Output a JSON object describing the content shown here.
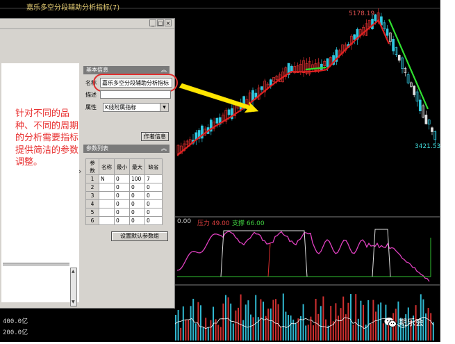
{
  "chart": {
    "title": "嘉乐多空分段辅助分析指标(7)",
    "price_high": "5178.19",
    "price_low": "3421.53",
    "indicator_prefix": "0.00",
    "indicator_pressure": "压力 49.00",
    "indicator_support": "支撑 66.00",
    "volume_labels": [
      "400.0亿",
      "200.0亿"
    ],
    "colors": {
      "up": "#e03030",
      "down": "#30c8e0",
      "ma": "#e02020",
      "ma_down": "#30e030",
      "indicator": "#e040c0"
    }
  },
  "watermark": {
    "text": "期乐会",
    "icon": "wechat-icon"
  },
  "dialog": {
    "title_buttons": [
      "_",
      "□",
      "×"
    ],
    "note_text": "针对不同的品种、不同的周期的分析需要指标提供简洁的参数调整。",
    "basic_info": {
      "header": "基本信息",
      "name_label": "名称",
      "name_value": "嘉乐多空分段辅助分析指标",
      "desc_label": "描述",
      "desc_value": "",
      "attr_label": "属性",
      "attr_value": "K线附属指标",
      "author_button": "作者信息"
    },
    "param_list": {
      "header": "参数列表",
      "columns": [
        "参数",
        "名称",
        "最小",
        "最大",
        "缺省"
      ],
      "rows": [
        [
          "1",
          "N",
          "0",
          "100",
          "7"
        ],
        [
          "2",
          "",
          "0",
          "0",
          "0"
        ],
        [
          "3",
          "",
          "0",
          "0",
          "0"
        ],
        [
          "4",
          "",
          "0",
          "0",
          "0"
        ],
        [
          "5",
          "",
          "0",
          "0",
          "0"
        ],
        [
          "6",
          "",
          "0",
          "0",
          "0"
        ]
      ],
      "default_button": "设置默认参数组"
    }
  }
}
